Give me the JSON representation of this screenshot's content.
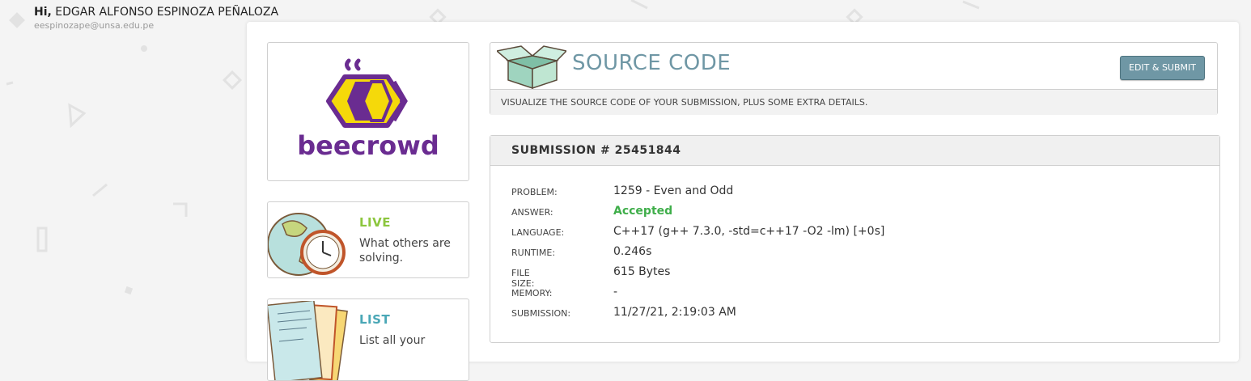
{
  "user": {
    "greeting": "Hi,",
    "name": "EDGAR ALFONSO ESPINOZA PEÑALOZA",
    "email": "eespinozape@unsa.edu.pe"
  },
  "logo": {
    "text": "beecrowd"
  },
  "sidebar": {
    "live": {
      "title": "LIVE",
      "description": "What others are solving.",
      "color": "#8cc63e",
      "icon": "globe-clock-icon"
    },
    "list": {
      "title": "LIST",
      "description": "List all your",
      "color": "#4aa7b6",
      "icon": "papers-icon"
    }
  },
  "source": {
    "title": "SOURCE CODE",
    "edit_button": "EDIT & SUBMIT",
    "subtitle": "VISUALIZE THE SOURCE CODE OF YOUR SUBMISSION, PLUS SOME EXTRA DETAILS.",
    "icon": "open-box-icon"
  },
  "submission": {
    "header": "SUBMISSION # 25451844",
    "rows": [
      {
        "label": "PROBLEM:",
        "value": "1259 - Even and Odd"
      },
      {
        "label": "ANSWER:",
        "value": "Accepted"
      },
      {
        "label": "LANGUAGE:",
        "value": "C++17 (g++ 7.3.0, -std=c++17 -O2 -lm) [+0s]"
      },
      {
        "label": "RUNTIME:",
        "value": "0.246s"
      },
      {
        "label": "FILE SIZE:",
        "value": "615 Bytes"
      },
      {
        "label": "MEMORY:",
        "value": "-"
      },
      {
        "label": "SUBMISSION:",
        "value": "11/27/21, 2:19:03 AM"
      }
    ]
  },
  "colors": {
    "accent": "#6f97a5",
    "accepted": "#3fae4a",
    "brand": "#6a2c91",
    "brand_yellow": "#f5d90a"
  }
}
